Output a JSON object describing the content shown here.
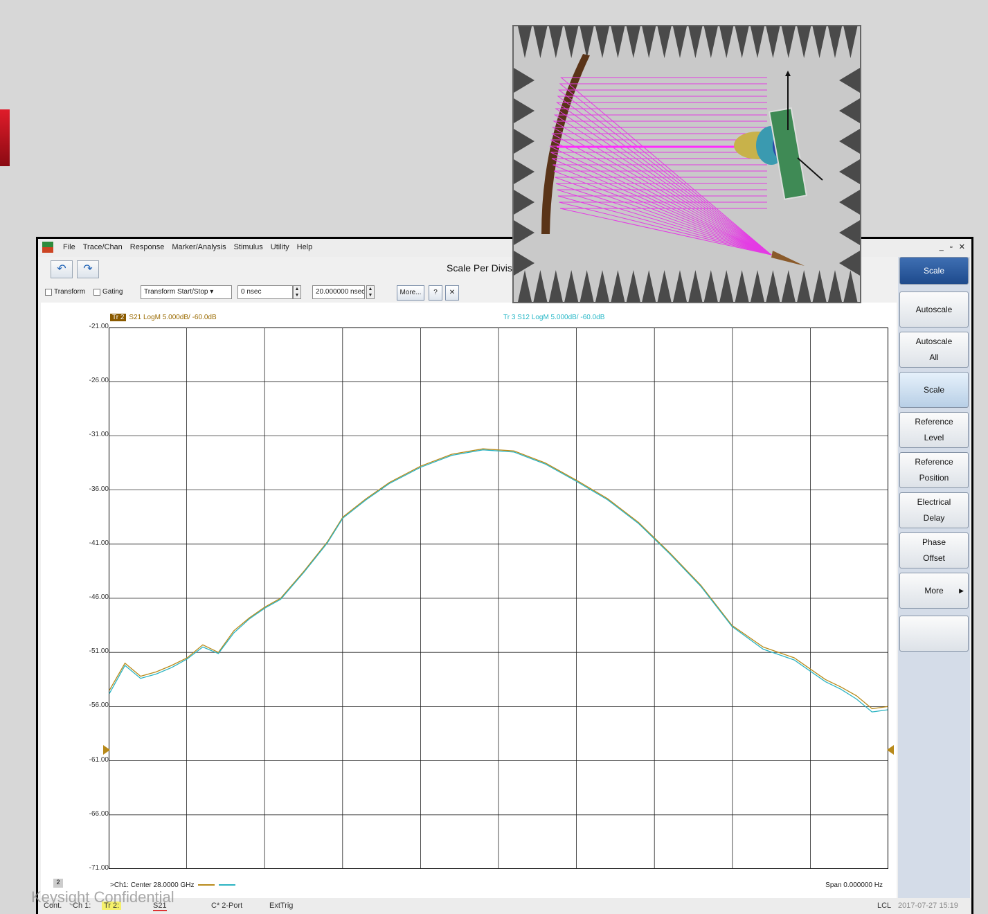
{
  "menu": [
    "File",
    "Trace/Chan",
    "Response",
    "Marker/Analysis",
    "Stimulus",
    "Utility",
    "Help"
  ],
  "window_controls": "_ ▫ ✕",
  "toolbar": {
    "undo_icon": "undo-icon",
    "redo_icon": "redo-icon",
    "title": "Scale Per Divisi"
  },
  "transform_bar": {
    "transform_label": "Transform",
    "gating_label": "Gating",
    "mode": "Transform Start/Stop",
    "start": "0 nsec",
    "stop": "20.000000 nsec",
    "more": "More...",
    "help": "?",
    "close": "✕"
  },
  "trace_labels": {
    "tr2_badge": "Tr 2",
    "tr2": "S21 LogM 5.000dB/ -60.0dB",
    "tr3": "Tr 3  S12 LogM 5.000dB/ -60.0dB"
  },
  "colors": {
    "trace_s21": "#b88a1a",
    "trace_s12": "#2bb3c2",
    "softkey_title": "#1d4a8c",
    "grid": "#000000"
  },
  "chart_data": {
    "type": "line",
    "ylim": [
      -71,
      -21
    ],
    "yticks": [
      "-21.00",
      "-26.00",
      "-31.00",
      "-36.00",
      "-41.00",
      "-46.00",
      "-51.00",
      "-56.00",
      "-61.00",
      "-66.00",
      "-71.00"
    ],
    "reference_level": -60,
    "x": [
      0,
      0.02,
      0.04,
      0.06,
      0.08,
      0.1,
      0.12,
      0.14,
      0.16,
      0.18,
      0.2,
      0.22,
      0.25,
      0.28,
      0.3,
      0.33,
      0.36,
      0.4,
      0.44,
      0.48,
      0.52,
      0.56,
      0.6,
      0.64,
      0.68,
      0.72,
      0.76,
      0.8,
      0.84,
      0.88,
      0.9,
      0.92,
      0.94,
      0.96,
      0.98,
      1.0
    ],
    "series": [
      {
        "values": [
          -54.5,
          -52,
          -53.2,
          -52.8,
          -52.2,
          -51.5,
          -50.3,
          -51,
          -49,
          -47.8,
          -46.8,
          -46,
          -43.5,
          -40.8,
          -38.5,
          -36.8,
          -35.3,
          -33.8,
          -32.7,
          -32.2,
          -32.4,
          -33.5,
          -35.1,
          -36.8,
          -39,
          -41.8,
          -44.8,
          -48.5,
          -50.5,
          -51.5,
          -52.5,
          -53.5,
          -54.2,
          -55,
          -56.2,
          -56
        ]
      },
      {
        "values": [
          -54.8,
          -52.2,
          -53.4,
          -53,
          -52.4,
          -51.6,
          -50.5,
          -51.1,
          -49.2,
          -47.9,
          -46.9,
          -46.1,
          -43.6,
          -40.9,
          -38.6,
          -36.9,
          -35.4,
          -33.9,
          -32.8,
          -32.3,
          -32.5,
          -33.6,
          -35.2,
          -36.9,
          -39.1,
          -41.9,
          -44.9,
          -48.6,
          -50.7,
          -51.7,
          -52.7,
          -53.7,
          -54.4,
          -55.3,
          -56.5,
          -56.3
        ]
      }
    ]
  },
  "footer": {
    "channel_num": "2",
    "center": ">Ch1:  Center  28.0000 GHz",
    "span": "Span 0.000000 Hz"
  },
  "status": {
    "cont": "Cont.",
    "ch1": "Ch 1:",
    "tr2": "Tr 2:",
    "s21": "S21",
    "cal": "C* 2-Port",
    "trig": "ExtTrig",
    "lcl": "LCL",
    "datetime": "2017-07-27 15:19"
  },
  "watermark": "Keysight Confidential",
  "softkeys": {
    "title": "Scale",
    "items": [
      {
        "l1": "Autoscale",
        "l2": ""
      },
      {
        "l1": "Autoscale",
        "l2": "All"
      },
      {
        "l1": "Scale",
        "l2": ""
      },
      {
        "l1": "Reference",
        "l2": "Level"
      },
      {
        "l1": "Reference",
        "l2": "Position"
      },
      {
        "l1": "Electrical",
        "l2": "Delay"
      },
      {
        "l1": "Phase",
        "l2": "Offset"
      },
      {
        "l1": "More",
        "l2": ""
      },
      {
        "l1": "",
        "l2": ""
      }
    ]
  }
}
